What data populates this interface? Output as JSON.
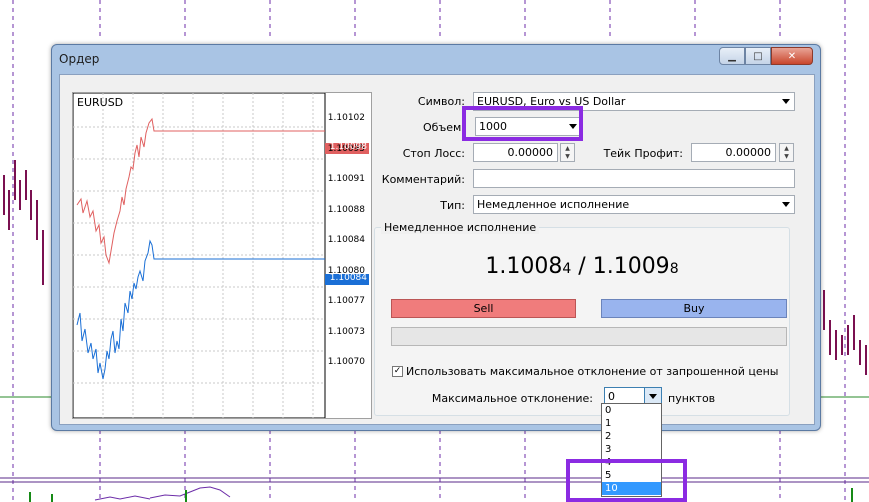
{
  "window": {
    "title": "Ордер"
  },
  "mini_chart": {
    "symbol": "EURUSD",
    "price_ticks": [
      "1.10102",
      "1.10095",
      "1.10091",
      "1.10088",
      "1.10084",
      "1.10080",
      "1.10077",
      "1.10073",
      "1.10070"
    ],
    "bid_label": "1.10084",
    "ask_label": "1.10098",
    "ask_color": "#e06060",
    "bid_color": "#1a6fd6"
  },
  "form": {
    "symbol_label": "Символ:",
    "symbol_value": "EURUSD, Euro vs US Dollar",
    "volume_label": "Объем:",
    "volume_value": "1000",
    "stoploss_label": "Стоп Лосс:",
    "stoploss_value": "0.00000",
    "takeprofit_label": "Тейк Профит:",
    "takeprofit_value": "0.00000",
    "comment_label": "Комментарий:",
    "comment_value": "",
    "type_label": "Тип:",
    "type_value": "Немедленное исполнение"
  },
  "execution": {
    "group_title": "Немедленное исполнение",
    "bid_main": "1.1008",
    "bid_small": "4",
    "separator": " / ",
    "ask_main": "1.1009",
    "ask_small": "8",
    "sell_label": "Sell",
    "buy_label": "Buy",
    "use_deviation_label": "Использовать максимальное отклонение от запрошенной цены",
    "use_deviation_checked": true,
    "deviation_label": "Максимальное отклонение:",
    "deviation_value": "0",
    "deviation_units": "пунктов",
    "deviation_options": [
      "0",
      "1",
      "2",
      "3",
      "4",
      "5",
      "10"
    ],
    "deviation_selected": "10"
  },
  "colors": {
    "highlight": "#8b2be2",
    "window_frame": "#a9c4e4"
  }
}
